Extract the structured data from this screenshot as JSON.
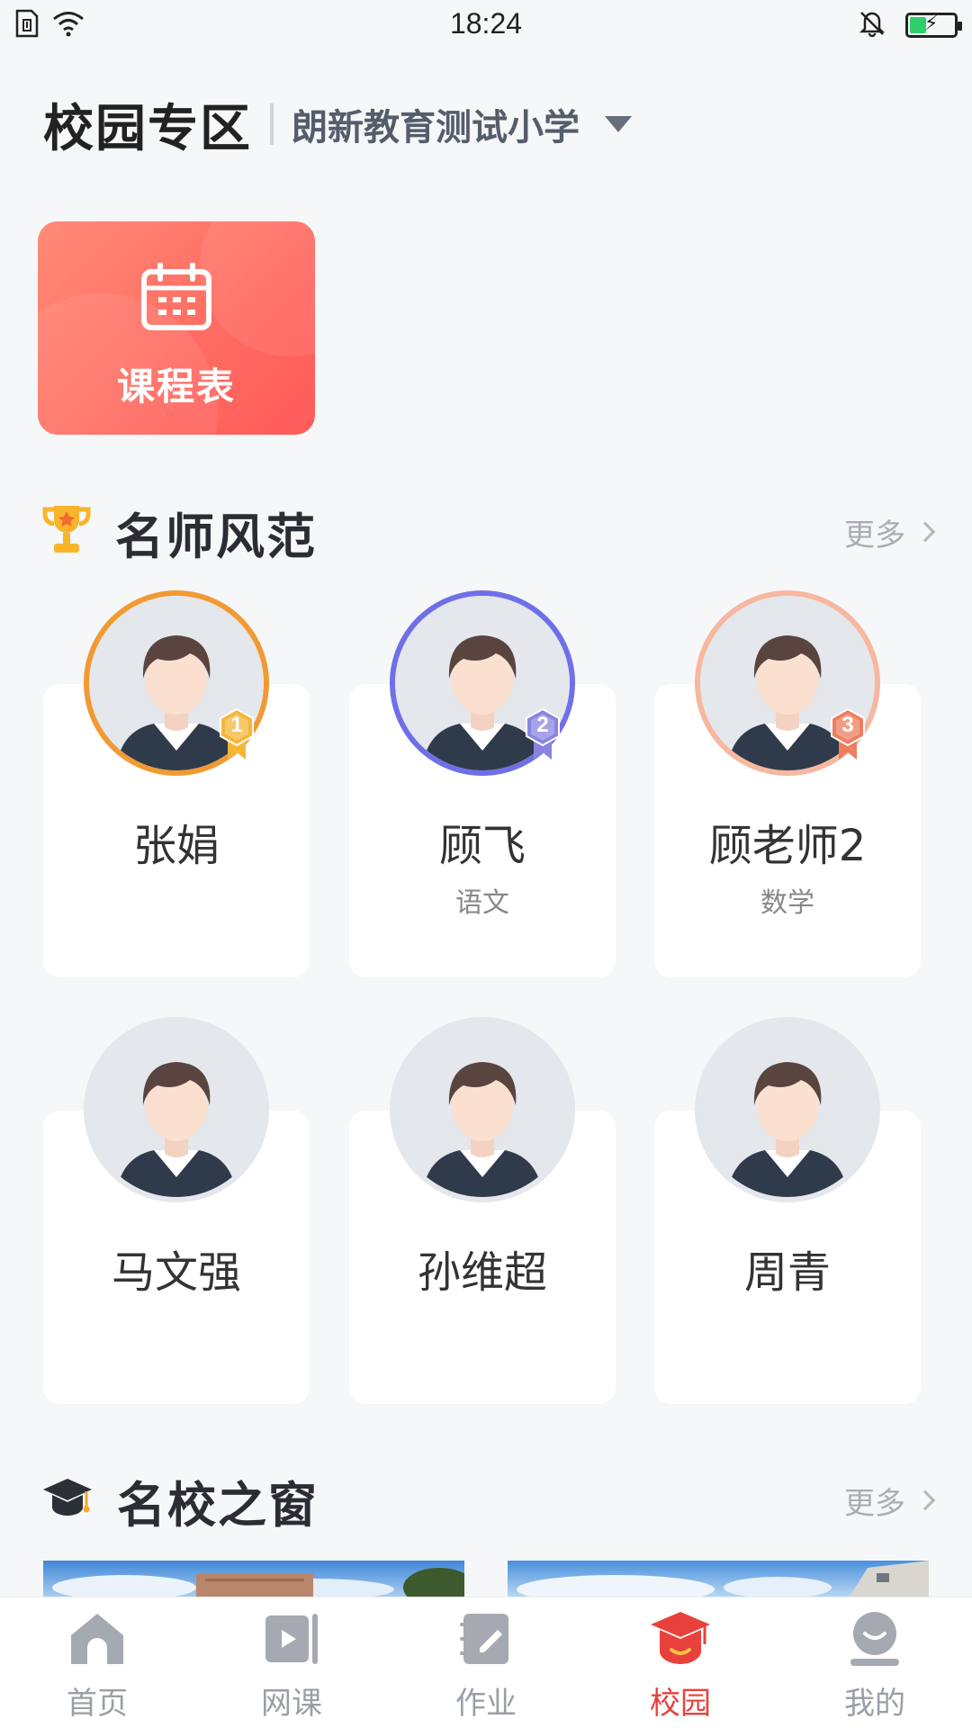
{
  "status_bar": {
    "time": "18:24",
    "icons": [
      "sim-card-icon",
      "wifi-icon",
      "bell-muted-icon",
      "battery-charging-icon"
    ],
    "battery_color": "#2ecf6a"
  },
  "header": {
    "title": "校园专区",
    "school": "朗新教育测试小学"
  },
  "shortcut": {
    "label": "课程表",
    "icon": "calendar-icon",
    "colors": [
      "#ff8a78",
      "#ff5a5a"
    ]
  },
  "teachers_section": {
    "title": "名师风范",
    "icon": "trophy-icon",
    "more": "更多",
    "teachers": [
      {
        "name": "张娟",
        "subject": "",
        "rank": "1",
        "ring_color": "#f29a32",
        "medal_color": "#f5b638"
      },
      {
        "name": "顾飞",
        "subject": "语文",
        "rank": "2",
        "ring_color": "#6f6fe8",
        "medal_color": "#8a84e0"
      },
      {
        "name": "顾老师2",
        "subject": "数学",
        "rank": "3",
        "ring_color": "#f7b7a0",
        "medal_color": "#ef7d5e"
      },
      {
        "name": "马文强",
        "subject": "",
        "rank": "",
        "ring_color": "",
        "medal_color": ""
      },
      {
        "name": "孙维超",
        "subject": "",
        "rank": "",
        "ring_color": "",
        "medal_color": ""
      },
      {
        "name": "周青",
        "subject": "",
        "rank": "",
        "ring_color": "",
        "medal_color": ""
      }
    ]
  },
  "schools_section": {
    "title": "名校之窗",
    "icon": "graduation-cap-icon",
    "more": "更多"
  },
  "bottom_nav": {
    "active_color": "#e8413c",
    "items": [
      {
        "label": "首页",
        "icon": "home-icon"
      },
      {
        "label": "网课",
        "icon": "video-icon"
      },
      {
        "label": "作业",
        "icon": "homework-icon"
      },
      {
        "label": "校园",
        "icon": "campus-icon",
        "active": true
      },
      {
        "label": "我的",
        "icon": "profile-icon"
      }
    ]
  }
}
